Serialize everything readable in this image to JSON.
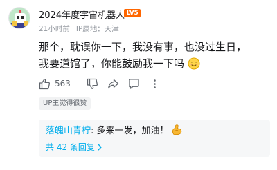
{
  "comment": {
    "username": "2024年度宇宙机器人",
    "level_badge": "LV5",
    "time": "21小时前",
    "ip_location": "IP属地：天津",
    "content": "那个，耽误你一下，我没有事，也没过生日，我要道馆了，你能鼓励我一下吗",
    "content_emoji_icon": "smiling-face-icon",
    "like_count": "563",
    "up_tag": "UP主觉得很赞"
  },
  "reply": {
    "username": "落魄山青柠",
    "separator": ":",
    "text": " 多来一发，加油！",
    "emoji_icon": "flexed-biceps-icon",
    "more_label": "共 42 条回复"
  },
  "colors": {
    "link_blue": "#00aeec",
    "level_orange": "#ff6600",
    "meta_gray": "#9499a0"
  }
}
